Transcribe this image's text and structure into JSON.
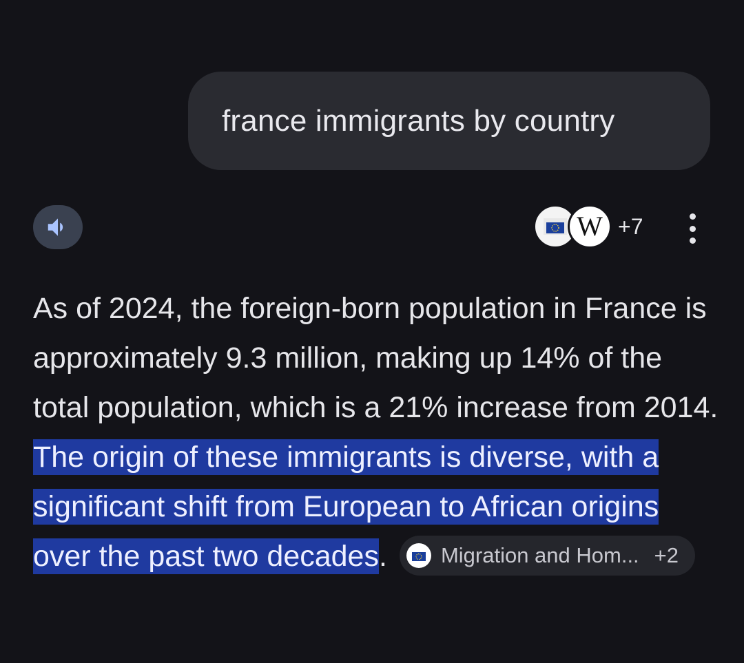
{
  "query": {
    "text": "france immigrants by country"
  },
  "toolbar": {
    "speaker_icon": "volume-icon",
    "sources_count": "+7",
    "source_icons": [
      "eu-flag-icon",
      "wikipedia-icon"
    ],
    "wiki_letter": "W",
    "more_icon": "more-vert-icon"
  },
  "answer": {
    "plain_text": "As of 2024, the foreign-born population in France is approximately 9.3 million, making up 14% of the total population, which is a 21% increase from 2014. ",
    "highlighted_text": "The origin of these immigrants is diverse, with a significant shift from European to African origins over the past two decades",
    "trailing_text": ".",
    "citation": {
      "label": "Migration and Hom...",
      "count": "+2",
      "icon": "eu-flag-icon"
    }
  },
  "colors": {
    "background": "#131318",
    "bubble": "#2a2b31",
    "highlight": "#1f3aa0",
    "speaker_button": "#3a4150",
    "speaker_icon": "#aac4ff"
  }
}
